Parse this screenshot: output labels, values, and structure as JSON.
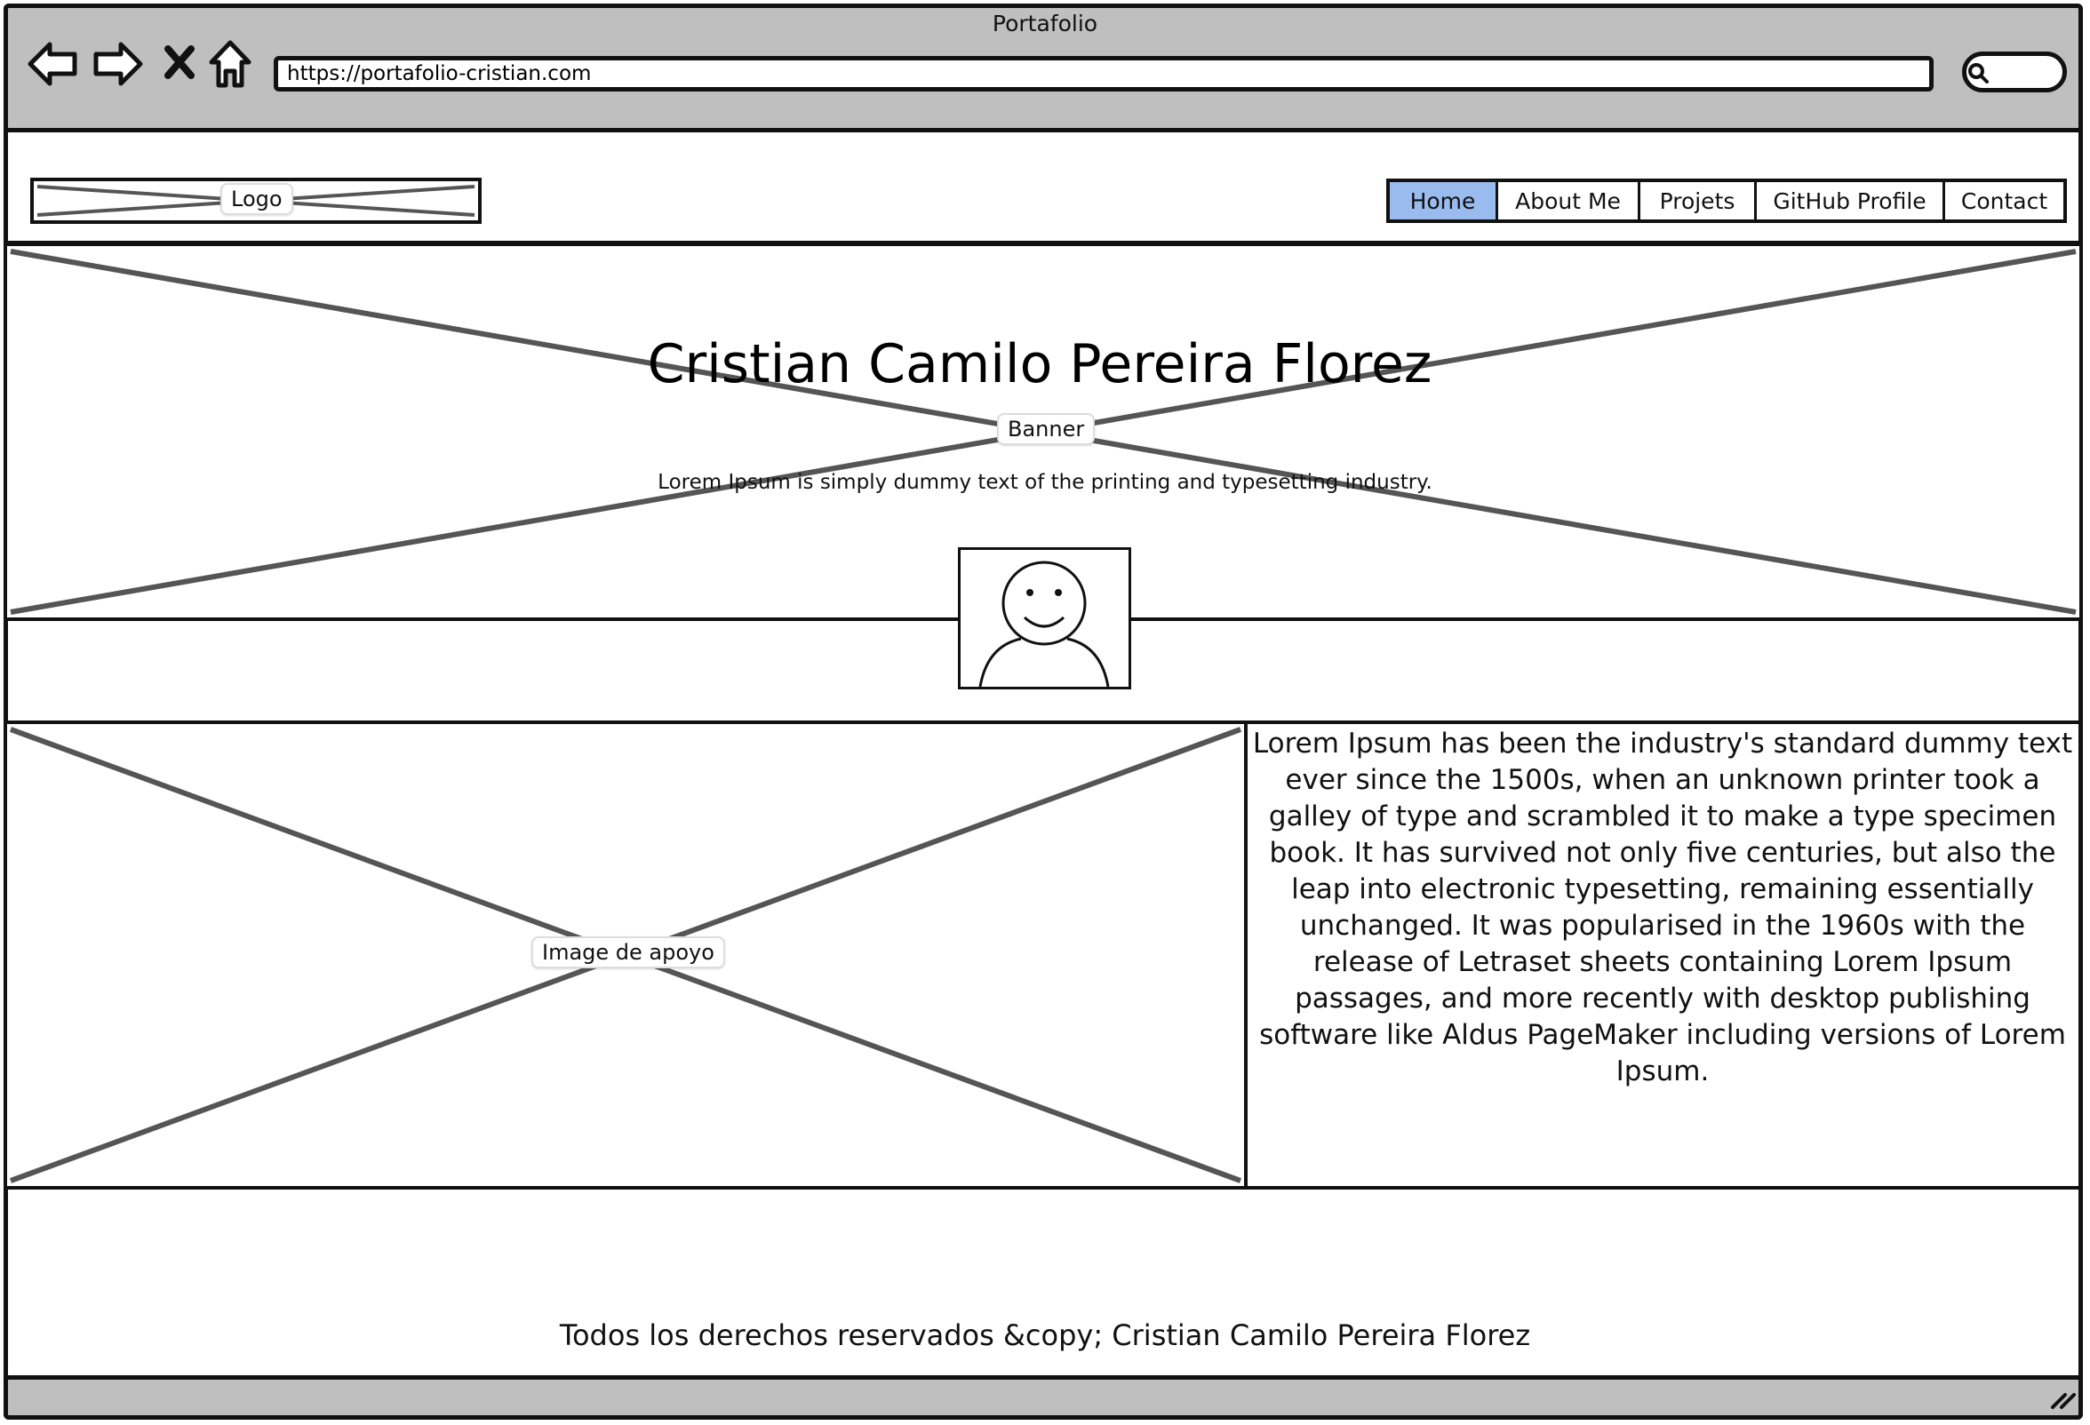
{
  "browser": {
    "window_title": "Portafolio",
    "url": "https://portafolio-cristian.com",
    "icons": [
      "back-arrow-icon",
      "forward-arrow-icon",
      "stop-icon",
      "home-icon",
      "search-icon",
      "resize-grip-icon"
    ]
  },
  "header": {
    "logo_label": "Logo",
    "nav": [
      {
        "label": "Home",
        "active": true
      },
      {
        "label": "About Me",
        "active": false
      },
      {
        "label": "Projets",
        "active": false
      },
      {
        "label": "GitHub Profile",
        "active": false
      },
      {
        "label": "Contact",
        "active": false
      }
    ]
  },
  "banner": {
    "title": "Cristian Camilo Pereira Florez",
    "label": "Banner",
    "subtitle": "Lorem Ipsum is simply dummy text of the printing and typesetting industry."
  },
  "content": {
    "image_label": "Image de apoyo",
    "paragraph": "Lorem Ipsum has been the industry's standard dummy text ever since the 1500s, when an unknown printer took a galley of type and scrambled it to make a type specimen book. It has survived not only five centuries, but also the leap into electronic typesetting, remaining essentially unchanged. It was popularised in the 1960s with the release of Letraset sheets containing Lorem Ipsum passages, and more recently with desktop publishing software like Aldus PageMaker including versions of Lorem Ipsum."
  },
  "footer": {
    "text": "Todos los derechos reservados &copy; Cristian Camilo Pereira Florez"
  },
  "colors": {
    "chrome": "#bfbfbf",
    "active_nav": "#99bbee",
    "placeholder_cross": "#555555"
  }
}
